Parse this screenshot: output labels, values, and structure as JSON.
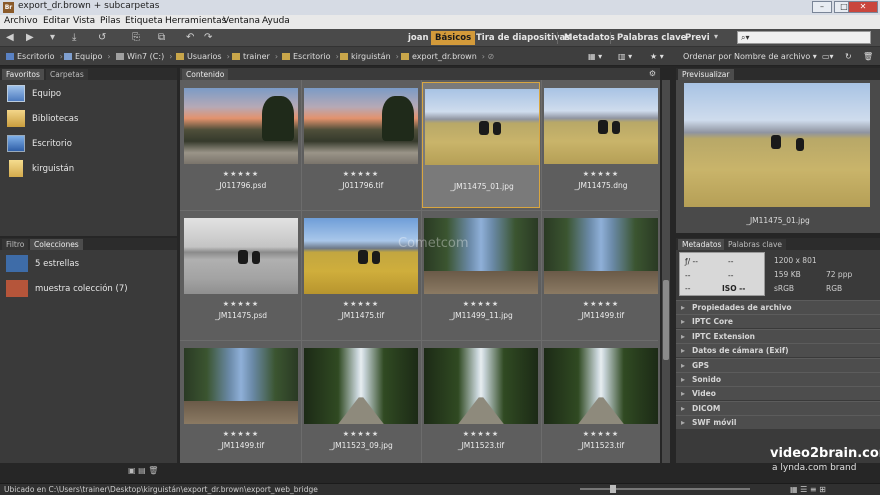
{
  "window": {
    "title": "export_dr.brown + subcarpetas",
    "app_icon": "Br"
  },
  "menu": [
    "Archivo",
    "Editar",
    "Vista",
    "Pilas",
    "Etiqueta",
    "Herramientas",
    "Ventana",
    "Ayuda"
  ],
  "workspaces": {
    "user": "joan",
    "items": [
      "Básicos",
      "Tira de diapositivas",
      "Metadatos",
      "Palabras clave",
      "Previ"
    ],
    "active": "Básicos",
    "accent_color": "#d39a3a"
  },
  "search": {
    "placeholder": ""
  },
  "path": {
    "crumbs": [
      "Escritorio",
      "Equipo",
      "Win7 (C:)",
      "Usuarios",
      "trainer",
      "Escritorio",
      "kirguistán",
      "export_dr.brown"
    ],
    "sort_label": "Ordenar por Nombre de archivo"
  },
  "left_top": {
    "tabs": [
      "Favoritos",
      "Carpetas"
    ],
    "items": [
      "Equipo",
      "Bibliotecas",
      "Escritorio",
      "kirguistán"
    ]
  },
  "left_bottom": {
    "tabs": [
      "Filtro",
      "Colecciones"
    ],
    "items": [
      "5 estrellas",
      "muestra colección (7)"
    ]
  },
  "content": {
    "tab": "Contenido",
    "items": [
      {
        "name": "_J011796.psd",
        "stars": "★★★★★",
        "thumb": "sunset"
      },
      {
        "name": "_J011796.tif",
        "stars": "★★★★★",
        "thumb": "sunset"
      },
      {
        "name": "_JM11475_01.jpg",
        "stars": "",
        "thumb": "plain"
      },
      {
        "name": "_JM11475.dng",
        "stars": "★★★★★",
        "thumb": "plain"
      },
      {
        "name": "_JM11475.psd",
        "stars": "★★★★★",
        "thumb": "bw"
      },
      {
        "name": "_JM11475.tif",
        "stars": "★★★★★",
        "thumb": "plain-sat"
      },
      {
        "name": "_JM11499_11.jpg",
        "stars": "★★★★★",
        "thumb": "trees"
      },
      {
        "name": "_JM11499.tif",
        "stars": "★★★★★",
        "thumb": "trees"
      },
      {
        "name": "_JM11499.tif",
        "stars": "★★★★★",
        "thumb": "trees"
      },
      {
        "name": "_JM11523_09.jpg",
        "stars": "★★★★★",
        "thumb": "alley"
      },
      {
        "name": "_JM11523.tif",
        "stars": "★★★★★",
        "thumb": "alley"
      },
      {
        "name": "_JM11523.tif",
        "stars": "★★★★★",
        "thumb": "alley"
      }
    ],
    "selected_index": 2
  },
  "preview": {
    "tab": "Previsualizar",
    "caption": "_JM11475_01.jpg"
  },
  "metadata": {
    "tabs": [
      "Metadatos",
      "Palabras clave"
    ],
    "camera": {
      "fstop": "ƒ/ --",
      "shutter": "--",
      "iso": "ISO --"
    },
    "info": {
      "dimensions": "1200 x 801",
      "size": "159 KB",
      "resolution": "72 ppp",
      "profile": "sRGB",
      "mode": "RGB"
    },
    "sections": [
      "Propiedades de archivo",
      "IPTC Core",
      "IPTC Extension",
      "Datos de cámara (Exif)",
      "GPS",
      "Sonido",
      "Video",
      "DICOM",
      "SWF móvil"
    ]
  },
  "statusbar": {
    "text": "Ubicado en C:\\Users\\trainer\\Desktop\\kirguistán\\export_dr.brown\\export_web_bridge"
  },
  "watermarks": {
    "brand": "video2brain.com",
    "sub": "a lynda.com brand",
    "overlay": "Cometcom"
  }
}
